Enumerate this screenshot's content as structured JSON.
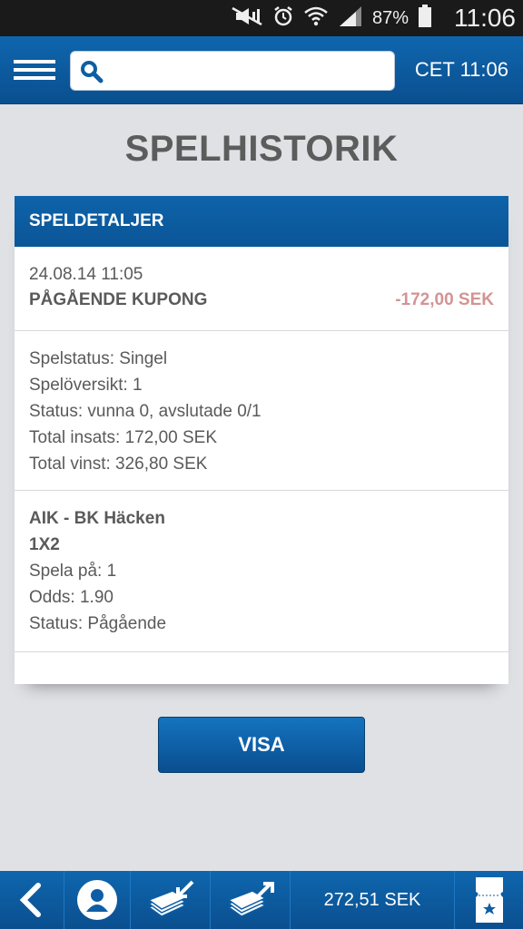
{
  "status_bar": {
    "battery_percent": "87%",
    "time": "11:06",
    "icons": [
      "mute-icon",
      "alarm-icon",
      "wifi-icon",
      "signal-icon",
      "battery-icon"
    ]
  },
  "header": {
    "menu_icon": "hamburger-icon",
    "search": {
      "icon": "search-icon",
      "placeholder": "",
      "value": ""
    },
    "clock": "CET 11:06"
  },
  "page": {
    "title": "SPELHISTORIK"
  },
  "card": {
    "header": "SPELDETALJER",
    "summary": {
      "date": "24.08.14 11:05",
      "type": "PÅGÅENDE KUPONG",
      "amount": "-172,00 SEK"
    },
    "details": [
      "Spelstatus: Singel",
      "Spelöversikt: 1",
      "Status: vunna 0, avslutade 0/1",
      "Total insats: 172,00 SEK",
      "Total vinst: 326,80 SEK"
    ],
    "bet": {
      "match": "AIK - BK Häcken",
      "market": "1X2",
      "lines": [
        "Spela på: 1",
        "Odds: 1.90",
        "Status: Pågående"
      ]
    }
  },
  "button": {
    "label": "VISA"
  },
  "bottom_bar": {
    "balance": "272,51 SEK",
    "icons": [
      "back-icon",
      "account-icon",
      "withdraw-icon",
      "deposit-icon",
      "coupon-icon"
    ]
  },
  "colors": {
    "primary": "#0d5ea4",
    "amount_negative": "#d49393",
    "background": "#dfe1e4"
  }
}
